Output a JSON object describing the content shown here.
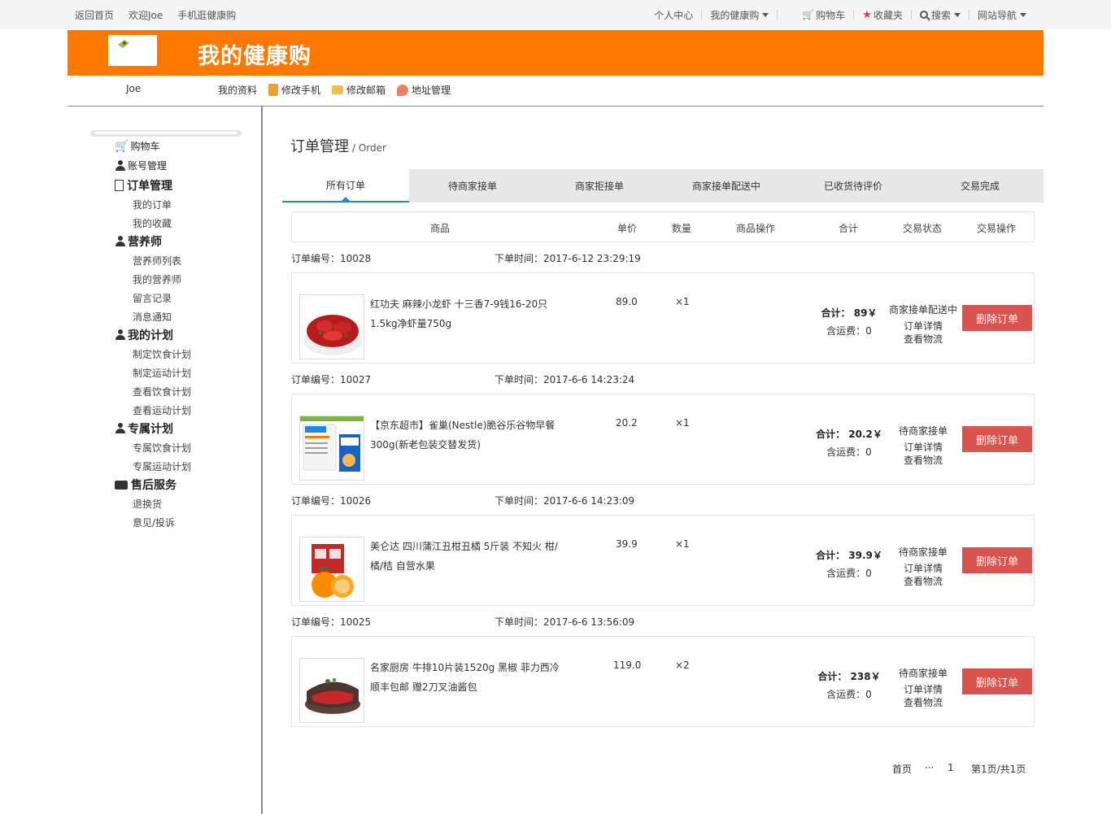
{
  "topbar": {
    "home": "返回首页",
    "welcome": "欢迎Joe",
    "mobile": "手机逛健康购",
    "personal_center": "个人中心",
    "my_shop": "我的健康购",
    "cart": "购物车",
    "favorites": "收藏夹",
    "search": "搜索",
    "site_nav": "网站导航"
  },
  "banner": {
    "brand": "我的健康购"
  },
  "subnav": {
    "user": "Joe",
    "my_profile": "我的资料",
    "change_phone": "修改手机",
    "change_email": "修改邮箱",
    "address": "地址管理"
  },
  "sidebar": {
    "cart": "购物车",
    "account": "账号管理",
    "orders": "订单管理",
    "my_orders": "我的订单",
    "my_favorites": "我的收藏",
    "nutritionist": "营养师",
    "nutritionist_list": "营养师列表",
    "my_nutritionist": "我的营养师",
    "messages": "留言记录",
    "notifications": "消息通知",
    "my_plan": "我的计划",
    "diet_plan": "制定饮食计划",
    "exercise_plan": "制定运动计划",
    "view_diet": "查看饮食计划",
    "view_exercise": "查看运动计划",
    "exclusive_plan": "专属计划",
    "exclusive_diet": "专属饮食计划",
    "exclusive_exercise": "专属运动计划",
    "after_sales": "售后服务",
    "returns": "退换货",
    "complaints": "意见/投诉"
  },
  "main": {
    "title": "订单管理",
    "title_en": "/ Order",
    "tabs": [
      "所有订单",
      "待商家接单",
      "商家拒接单",
      "商家接单配送中",
      "已收货待评价",
      "交易完成"
    ],
    "headers": {
      "product": "商品",
      "unit_price": "单价",
      "quantity": "数量",
      "product_ops": "商品操作",
      "total": "合计",
      "status": "交易状态",
      "ops": "交易操作"
    },
    "orders": [
      {
        "no": "订单编号：10028",
        "time": "下单时间：2017-6-12 23:29:19",
        "name": "红功夫 麻辣小龙虾 十三香7-9钱16-20只 1.5kg净虾量750g",
        "price": "89.0",
        "qty": "×1",
        "total": "合计： 89￥",
        "shipping": "含运费：0",
        "status": "商家接单配送中",
        "detail": "订单详情",
        "logistics": "查看物流",
        "delete": "删除订单"
      },
      {
        "no": "订单编号：10027",
        "time": "下单时间：2017-6-6 14:23:24",
        "name": "【京东超市】雀巢(Nestle)脆谷乐谷物早餐300g(新老包装交替发货)",
        "price": "20.2",
        "qty": "×1",
        "total": "合计： 20.2￥",
        "shipping": "含运费：0",
        "status": "待商家接单",
        "detail": "订单详情",
        "logistics": "查看物流",
        "delete": "删除订单"
      },
      {
        "no": "订单编号：10026",
        "time": "下单时间：2017-6-6 14:23:09",
        "name": "美仑达 四川蒲江丑柑丑橘 5斤装 不知火 柑/橘/桔 自营水果",
        "price": "39.9",
        "qty": "×1",
        "total": "合计： 39.9￥",
        "shipping": "含运费：0",
        "status": "待商家接单",
        "detail": "订单详情",
        "logistics": "查看物流",
        "delete": "删除订单"
      },
      {
        "no": "订单编号：10025",
        "time": "下单时间：2017-6-6 13:56:09",
        "name": "名家厨房 牛排10片装1520g 黑椒 菲力西冷 顺丰包邮 赠2刀叉油酱包",
        "price": "119.0",
        "qty": "×2",
        "total": "合计： 238￥",
        "shipping": "含运费：0",
        "status": "待商家接单",
        "detail": "订单详情",
        "logistics": "查看物流",
        "delete": "删除订单"
      }
    ],
    "pager": {
      "first": "首页",
      "ellipsis": "···",
      "page": "1",
      "info": "第1页/共1页"
    }
  },
  "colors": {
    "brand_orange": "#ff7800",
    "delete_red": "#d9534f",
    "tab_accent": "#1e88d0"
  }
}
